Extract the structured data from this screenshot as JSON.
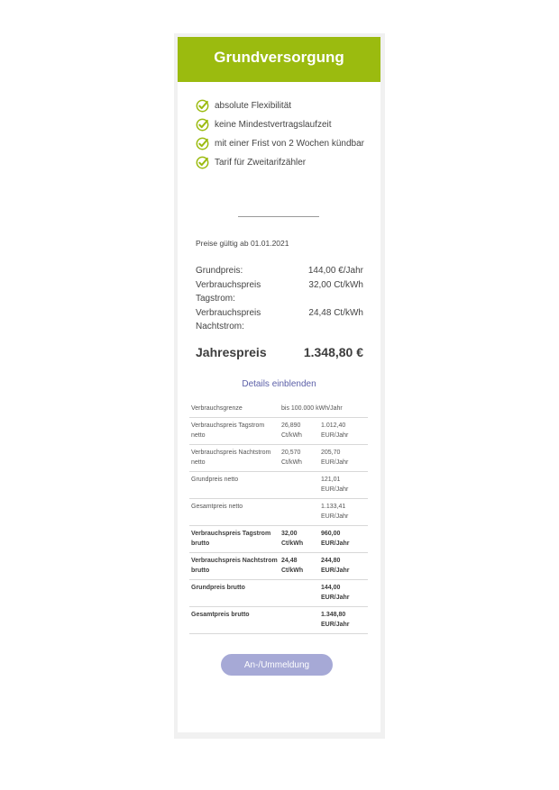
{
  "header": {
    "title": "Grundversorgung",
    "color": "#9bbb0f"
  },
  "features": [
    {
      "icon": "check-icon",
      "text": "absolute Flexibilität"
    },
    {
      "icon": "check-icon",
      "text": "keine Mindestvertragslaufzeit"
    },
    {
      "icon": "check-icon",
      "text": "mit einer Frist von 2 Wochen kündbar"
    },
    {
      "icon": "check-icon",
      "text": "Tarif für Zweitarifzähler"
    }
  ],
  "valid_from": "Preise gültig ab 01.01.2021",
  "prices": [
    {
      "label": "Grundpreis:",
      "value": "144,00 €/Jahr"
    },
    {
      "label": "Verbrauchspreis Tagstrom:",
      "value": "32,00 Ct/kWh"
    },
    {
      "label": "Verbrauchspreis Nachtstrom:",
      "value": "24,48 Ct/kWh"
    }
  ],
  "annual": {
    "label": "Jahrespreis",
    "value": "1.348,80 €"
  },
  "details_link": "Details einblenden",
  "details_table": [
    {
      "c1": "Verbrauchsgrenze",
      "c2": "bis 100.000 kWh/Jahr",
      "c3": "",
      "bold": false
    },
    {
      "c1": "Verbrauchspreis Tagstrom netto",
      "c2": "26,890 Ct/kWh",
      "c3": "1.012,40 EUR/Jahr",
      "bold": false
    },
    {
      "c1": "Verbrauchspreis Nachtstrom netto",
      "c2": "20,570 Ct/kWh",
      "c3": "205,70 EUR/Jahr",
      "bold": false
    },
    {
      "c1": "Grundpreis netto",
      "c2": "",
      "c3": "121,01 EUR/Jahr",
      "bold": false
    },
    {
      "c1": "Gesamtpreis netto",
      "c2": "",
      "c3": "1.133,41 EUR/Jahr",
      "bold": false
    },
    {
      "c1": "Verbrauchspreis Tagstrom brutto",
      "c2": "32,00 Ct/kWh",
      "c3": "960,00 EUR/Jahr",
      "bold": true
    },
    {
      "c1": "Verbrauchspreis Nachtstrom brutto",
      "c2": "24,48 Ct/kWh",
      "c3": "244,80 EUR/Jahr",
      "bold": true
    },
    {
      "c1": "Grundpreis brutto",
      "c2": "",
      "c3": "144,00 EUR/Jahr",
      "bold": true
    },
    {
      "c1": "Gesamtpreis brutto",
      "c2": "",
      "c3": "1.348,80 EUR/Jahr",
      "bold": true
    }
  ],
  "button": {
    "label": "An-/Ummeldung",
    "color": "#a6a9d6"
  },
  "colors": {
    "accent": "#9bbb0f",
    "link": "#5b5fa8"
  }
}
